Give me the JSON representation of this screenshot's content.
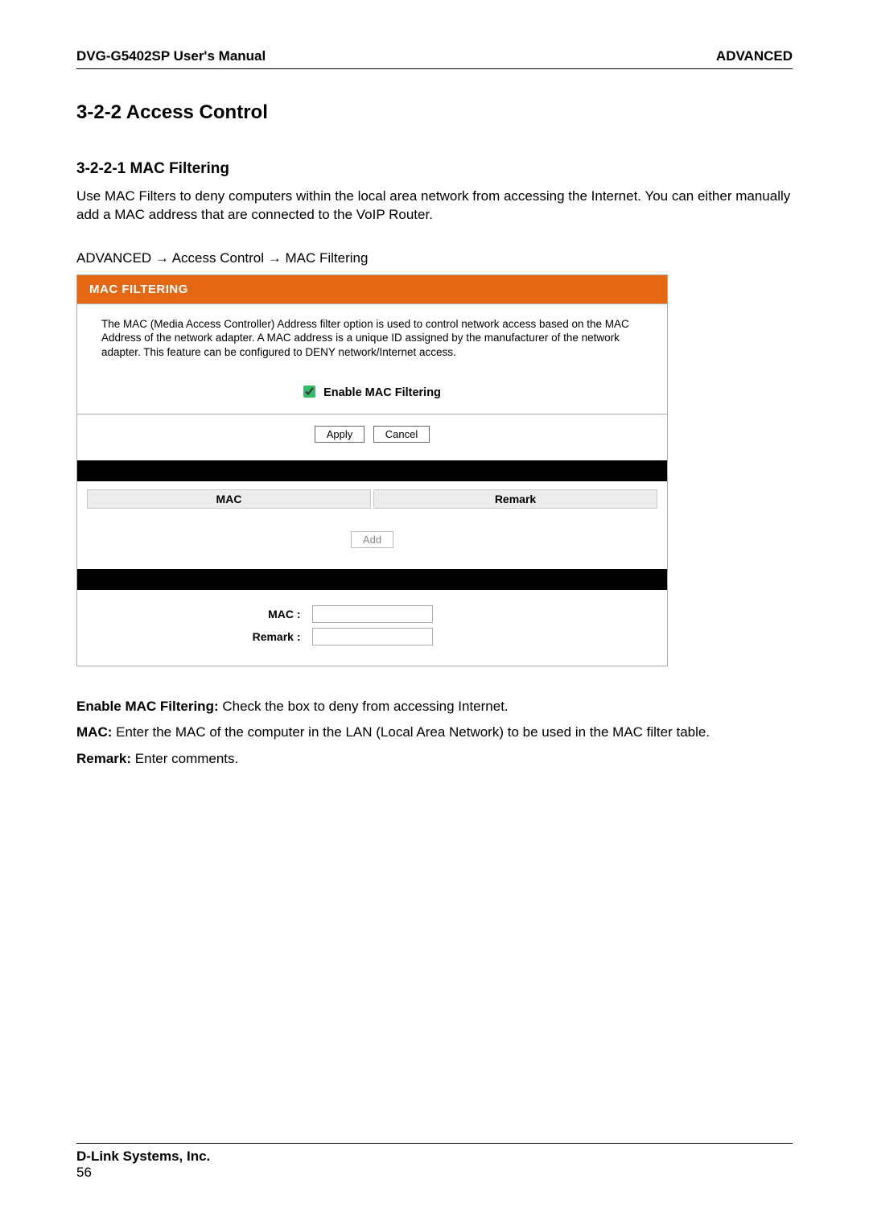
{
  "header": {
    "left": "DVG-G5402SP User's Manual",
    "right": "ADVANCED"
  },
  "section": {
    "title": "3-2-2 Access Control",
    "subtitle": "3-2-2-1 MAC Filtering",
    "intro": "Use MAC Filters to deny computers within the local area network from accessing the Internet. You can either manually add a MAC address that are connected to the VoIP Router.",
    "breadcrumb": "ADVANCED  →  Access Control  →  MAC Filtering"
  },
  "panel": {
    "title": "MAC FILTERING",
    "description": "The MAC (Media Access Controller) Address filter option is used to control network access based on the MAC Address of the network adapter. A MAC address is a unique ID assigned by the manufacturer of the network adapter. This feature can be configured to DENY network/Internet access.",
    "enable_label": "Enable MAC Filtering",
    "buttons": {
      "apply": "Apply",
      "cancel": "Cancel",
      "add": "Add"
    },
    "columns": {
      "mac": "MAC",
      "remark": "Remark"
    },
    "form": {
      "mac_label": "MAC :",
      "remark_label": "Remark :",
      "mac_value": "",
      "remark_value": ""
    }
  },
  "definitions": {
    "enable_term": "Enable MAC Filtering:",
    "enable_def": " Check the box to deny from accessing Internet.",
    "mac_term": "MAC:",
    "mac_def": " Enter the MAC of the computer in the LAN (Local Area Network) to be used in the MAC filter table.",
    "remark_term": "Remark:",
    "remark_def": " Enter comments."
  },
  "footer": {
    "company": "D-Link Systems, Inc.",
    "page": "56"
  }
}
